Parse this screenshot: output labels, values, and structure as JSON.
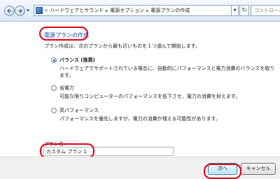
{
  "address_bar": {
    "breadcrumbs": [
      "ハードウェアとサウンド",
      "電源オプション",
      "電源プランの作成"
    ],
    "overflow_chevron": "«",
    "separator": "▸",
    "dropdown_glyph": "▼",
    "refresh_glyph": "↻",
    "search_placeholder": "コントロール"
  },
  "main": {
    "title": "電源プランの作成",
    "intro": "プラン作成は、次のプランから最も近いものを１つ選んで開始します。",
    "options": [
      {
        "label": "バランス (推奨)",
        "description": "ハードウェアでサポートされている場合に、自動的にパフォーマンスと電力消費のバランスを取ります。",
        "selected": true
      },
      {
        "label": "省電力",
        "description": "可能な限りコンピューターのパフォーマンスを低下させ、電力の消費を抑えます。",
        "selected": false
      },
      {
        "label": "高パフォーマンス",
        "description": "パフォーマンスを優先しますが、電力の消費が増える可能性があります。",
        "selected": false
      }
    ],
    "plan_name_label": "プラン名:",
    "plan_name_value": "カスタム プラン 1"
  },
  "footer": {
    "next_label": "次へ",
    "cancel_label": "キャンセル"
  },
  "colors": {
    "highlight": "#e00012",
    "title_link": "#1c3fa3"
  }
}
